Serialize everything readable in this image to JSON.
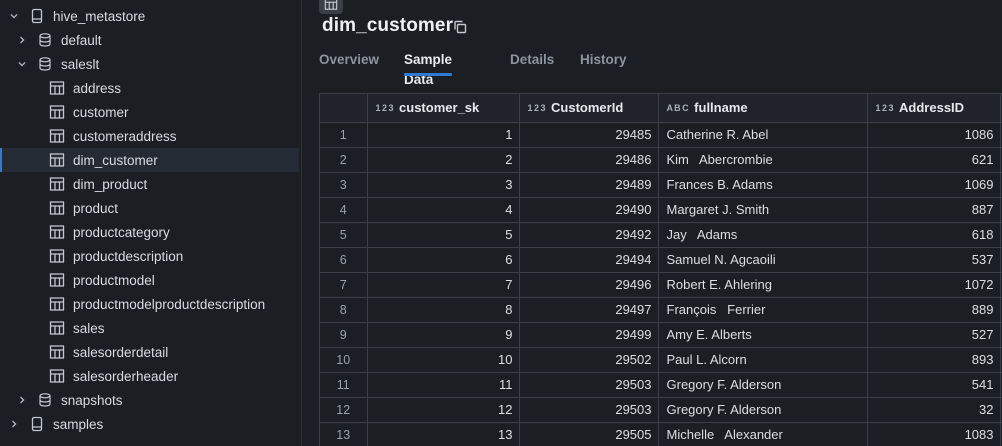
{
  "sidebar": {
    "root": "hive_metastore",
    "schemas": {
      "default": "default",
      "saleslt": "saleslt",
      "snapshots": "snapshots"
    },
    "tables": [
      "address",
      "customer",
      "customeraddress",
      "dim_customer",
      "dim_product",
      "product",
      "productcategory",
      "productdescription",
      "productmodel",
      "productmodelproductdescription",
      "sales",
      "salesorderdetail",
      "salesorderheader"
    ],
    "selected_table": "dim_customer",
    "catalog2": "samples"
  },
  "main": {
    "title": "dim_customer",
    "tabs": [
      "Overview",
      "Sample Data",
      "Details",
      "History"
    ],
    "active_tab": "Sample Data"
  },
  "grid": {
    "columns": [
      {
        "name": "customer_sk",
        "type": "1 2 3"
      },
      {
        "name": "CustomerId",
        "type": "1 2 3"
      },
      {
        "name": "fullname",
        "type": "A B C"
      },
      {
        "name": "AddressID",
        "type": "1 2 3"
      }
    ],
    "rows": [
      [
        "1",
        "1",
        "29485",
        "Catherine R. Abel",
        "1086"
      ],
      [
        "2",
        "2",
        "29486",
        "Kim   Abercrombie",
        "621"
      ],
      [
        "3",
        "3",
        "29489",
        "Frances B. Adams",
        "1069"
      ],
      [
        "4",
        "4",
        "29490",
        "Margaret J. Smith",
        "887"
      ],
      [
        "5",
        "5",
        "29492",
        "Jay   Adams",
        "618"
      ],
      [
        "6",
        "6",
        "29494",
        "Samuel N. Agcaoili",
        "537"
      ],
      [
        "7",
        "7",
        "29496",
        "Robert E. Ahlering",
        "1072"
      ],
      [
        "8",
        "8",
        "29497",
        "François   Ferrier",
        "889"
      ],
      [
        "9",
        "9",
        "29499",
        "Amy E. Alberts",
        "527"
      ],
      [
        "10",
        "10",
        "29502",
        "Paul L. Alcorn",
        "893"
      ],
      [
        "11",
        "11",
        "29503",
        "Gregory F. Alderson",
        "541"
      ],
      [
        "12",
        "12",
        "29503",
        "Gregory F. Alderson",
        "32"
      ],
      [
        "13",
        "13",
        "29505",
        "Michelle   Alexander",
        "1083"
      ]
    ]
  },
  "colors": {
    "background": "#1b1e23",
    "accent": "#2f7ad3",
    "grid_border": "#3a3f47",
    "selected_row": "#252b35"
  },
  "icons": {
    "expand": "chevron-right-icon",
    "collapse": "chevron-down-icon",
    "catalog": "catalog-icon",
    "schema": "database-icon",
    "table": "table-icon",
    "copy": "copy-icon"
  }
}
